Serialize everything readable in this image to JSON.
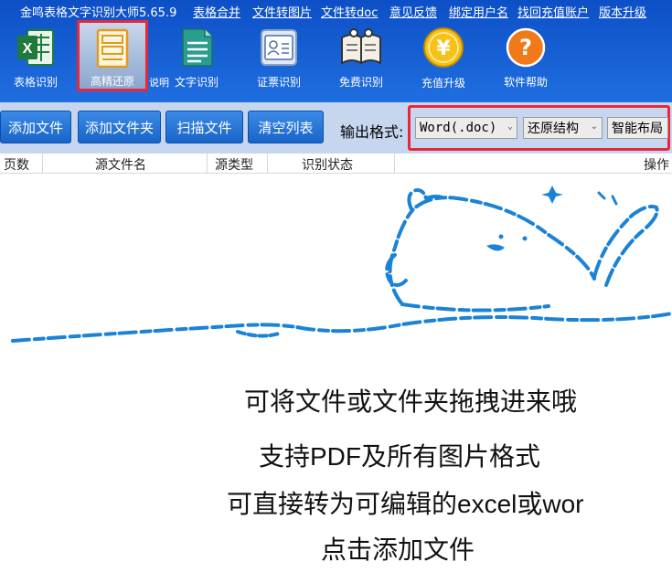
{
  "app": {
    "title": "金鸣表格文字识别大师5.65.9",
    "menu": [
      "表格合并",
      "文件转图片",
      "文件转doc",
      "意见反馈",
      "绑定用户名",
      "找回充值账户",
      "版本升级"
    ]
  },
  "tools": [
    {
      "label": "表格识别",
      "icon": "excel-icon"
    },
    {
      "label": "高精还原",
      "icon": "document-layout-icon"
    },
    {
      "label": "文字识别",
      "icon": "text-document-icon"
    },
    {
      "label": "证票识别",
      "icon": "id-card-icon"
    },
    {
      "label": "免费识别",
      "icon": "open-book-icon"
    },
    {
      "label": "充值升级",
      "icon": "yuan-coin-icon"
    },
    {
      "label": "软件帮助",
      "icon": "help-icon"
    }
  ],
  "tools_note": "说明",
  "toolbar": {
    "add_file": "添加文件",
    "add_folder": "添加文件夹",
    "scan_file": "扫描文件",
    "clear_list": "清空列表",
    "output_label": "输出格式:",
    "format_value": "Word(.doc)",
    "structure_value": "还原结构",
    "layout_value": "智能布局"
  },
  "table": {
    "columns": [
      "页数",
      "源文件名",
      "源类型",
      "识别状态",
      "操作"
    ]
  },
  "hints": [
    "可将文件或文件夹拖拽进来哦",
    "支持PDF及所有图片格式",
    "可直接转为可编辑的excel或wor",
    "点击添加文件"
  ],
  "colors": {
    "top_bar": "#1a5fd6",
    "toolbar_bg": "#c7d6ef",
    "button": "#1f6fd4",
    "highlight": "#e8283a",
    "mascot": "#1b83d6"
  }
}
